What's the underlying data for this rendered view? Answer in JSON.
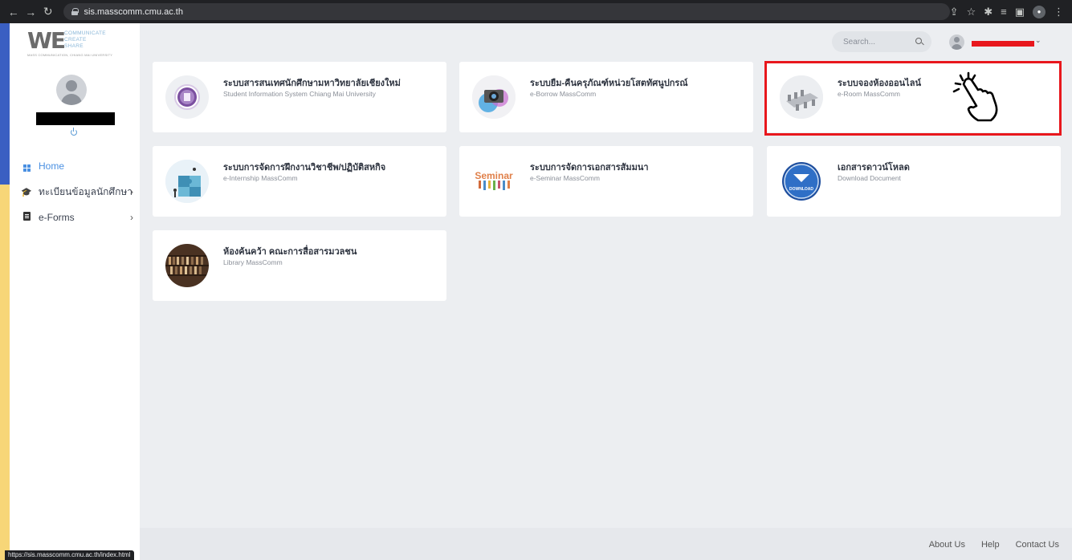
{
  "browser": {
    "url": "sis.masscomm.cmu.ac.th",
    "status_url": "https://sis.masscomm.cmu.ac.th/index.html"
  },
  "logo": {
    "mark": "WE",
    "words": [
      "COMMUNICATE",
      "CREATE",
      "SHARE"
    ],
    "subtitle": "MASS COMMUNICATION, CHIANG MAI UNIVERSITY"
  },
  "sidebar": {
    "items": [
      {
        "label": "Home",
        "icon": "grid-icon",
        "active": true
      },
      {
        "label": "ทะเบียนข้อมูลนักศึกษา",
        "icon": "graduation-cap-icon",
        "chevron": "›"
      },
      {
        "label": "e-Forms",
        "icon": "form-icon",
        "chevron": "›"
      }
    ]
  },
  "topbar": {
    "search_placeholder": "Search...",
    "user_chevron": "⌄"
  },
  "cards": [
    {
      "title": "ระบบสารสนเทศนักศึกษามหาวิทยาลัยเชียงใหม่",
      "subtitle": "Student Information System Chiang Mai University",
      "icon": "cmu-seal-icon"
    },
    {
      "title": "ระบบยืม-คืนครุภัณฑ์หน่วยโสตทัศนูปกรณ์",
      "subtitle": "e-Borrow MassComm",
      "icon": "camera-icon"
    },
    {
      "title": "ระบบจองห้องออนไลน์",
      "subtitle": "e-Room MassComm",
      "icon": "meeting-room-icon"
    },
    {
      "title": "ระบบการจัดการฝึกงานวิชาชีพ/ปฏิบัติสหกิจ",
      "subtitle": "e-Internship MassComm",
      "icon": "puzzle-icon"
    },
    {
      "title": "ระบบการจัดการเอกสารสัมมนา",
      "subtitle": "e-Seminar MassComm",
      "icon": "seminar-icon",
      "icon_text": "Seminar"
    },
    {
      "title": "เอกสารดาวน์โหลด",
      "subtitle": "Download Document",
      "icon": "download-icon",
      "icon_text": "DOWNLOAD"
    },
    {
      "title": "ห้องค้นคว้า คณะการสื่อสารมวลชน",
      "subtitle": "Library MassComm",
      "icon": "bookshelf-icon"
    }
  ],
  "footer": {
    "links": [
      "About Us",
      "Help",
      "Contact Us"
    ]
  },
  "colors": {
    "accent": "#4a90e2",
    "highlight": "#e8171d",
    "background": "#eceef1"
  }
}
